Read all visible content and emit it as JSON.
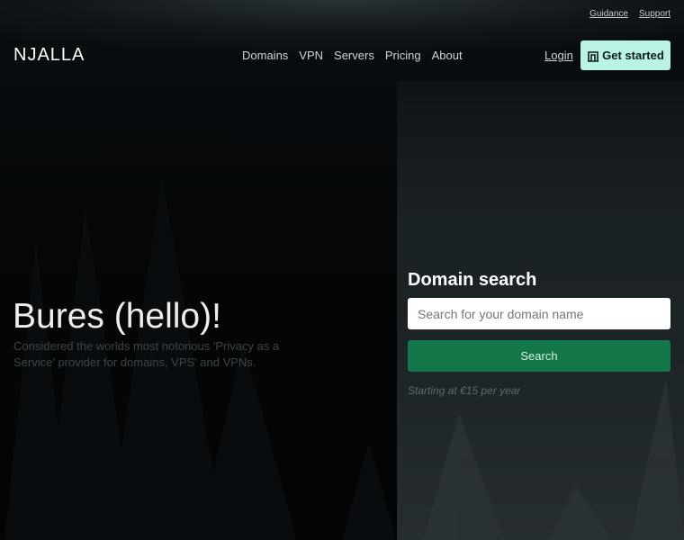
{
  "top_links": {
    "guidance": "Guidance",
    "support": "Support"
  },
  "logo": "NJALLA",
  "nav": [
    "Domains",
    "VPN",
    "Servers",
    "Pricing",
    "About"
  ],
  "login": "Login",
  "cta": {
    "label": "Get started",
    "icon": "building-icon"
  },
  "hero": {
    "title": "Bures (hello)!",
    "subtitle": "Considered the worlds most notorious 'Privacy as a Service' provider for domains, VPS' and VPNs."
  },
  "domain_search": {
    "title": "Domain search",
    "placeholder": "Search for your domain name",
    "button": "Search",
    "note": "Starting at €15 per year"
  },
  "colors": {
    "accent": "#b9f3e4",
    "search_button": "#14774a"
  }
}
